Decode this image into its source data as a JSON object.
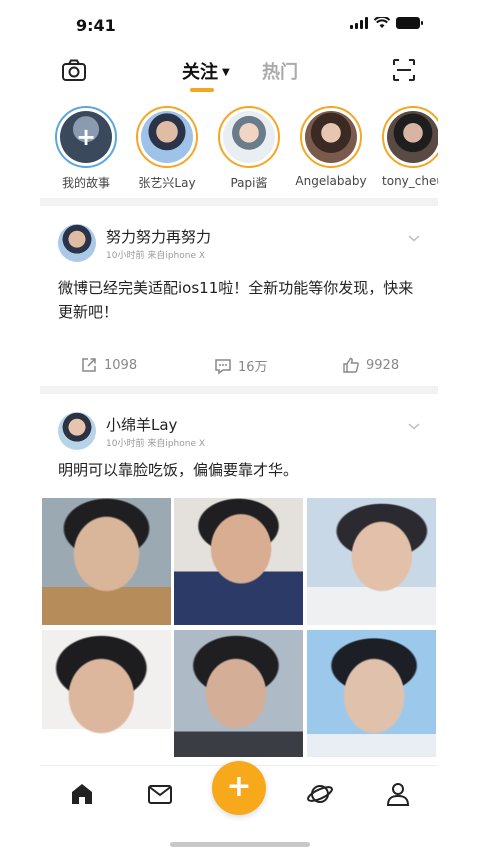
{
  "status_bar": {
    "time": "9:41"
  },
  "header": {
    "tab_follow": "关注",
    "tab_hot": "热门",
    "caret": "▼"
  },
  "stories": [
    {
      "label": "我的故事",
      "colors": [
        "#3a4a5c",
        "#8a9bb0"
      ]
    },
    {
      "label": "张艺兴Lay",
      "colors": [
        "#2a3348",
        "#9fc3e8"
      ]
    },
    {
      "label": "Papi酱",
      "colors": [
        "#bcd6e8",
        "#e9eef2"
      ]
    },
    {
      "label": "Angelababy",
      "colors": [
        "#3b2a24",
        "#d8b8a2"
      ]
    },
    {
      "label": "tony_cheu",
      "colors": [
        "#1e1e1e",
        "#c9a99a"
      ]
    }
  ],
  "post1": {
    "name": "努力努力再努力",
    "meta": "10小时前 来自iphone X",
    "text": "微博已经完美适配ios11啦！全新功能等你发现，快来更新吧！",
    "share_count": "1098",
    "comment_count": "16万",
    "like_count": "9928"
  },
  "post2": {
    "name": "小绵羊Lay",
    "meta": "10小时前 来自iphone X",
    "text": "明明可以靠脸吃饭，偏偏要靠才华。",
    "photos": [
      {
        "bg": "#9aa9b2",
        "skin": "#d9b59a"
      },
      {
        "bg": "#e4e0dc",
        "skin": "#d8ad92"
      },
      {
        "bg": "#c9d8e6",
        "skin": "#e2c0aa"
      },
      {
        "bg": "#f2f0ee",
        "skin": "#dcb79e"
      },
      {
        "bg": "#aebac6",
        "skin": "#d4ae96"
      },
      {
        "bg": "#9cc8ec",
        "skin": "#dfc1ac"
      }
    ]
  },
  "nav": {
    "fab_label": "+"
  },
  "colors": {
    "accent": "#f5a623",
    "fab": "#f7a81b"
  }
}
